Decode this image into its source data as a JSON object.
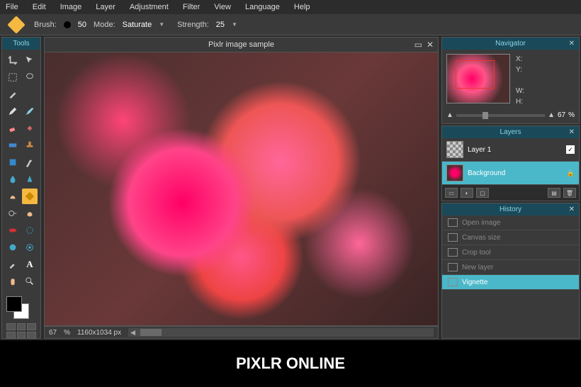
{
  "menu": {
    "file": "File",
    "edit": "Edit",
    "image": "Image",
    "layer": "Layer",
    "adjustment": "Adjustment",
    "filter": "Filter",
    "view": "View",
    "language": "Language",
    "help": "Help"
  },
  "options": {
    "brush_label": "Brush:",
    "brush_value": "50",
    "mode_label": "Mode:",
    "mode_value": "Saturate",
    "strength_label": "Strength:",
    "strength_value": "25"
  },
  "tools_header": "Tools",
  "canvas": {
    "title": "Pixlr image sample",
    "zoom": "67",
    "zoom_unit": "%",
    "dims": "1160x1034 px"
  },
  "navigator": {
    "title": "Navigator",
    "x": "X:",
    "y": "Y:",
    "w": "W:",
    "h": "H:",
    "zoom": "67",
    "unit": "%"
  },
  "layers": {
    "title": "Layers",
    "items": [
      {
        "name": "Layer 1",
        "selected": false,
        "checked": true
      },
      {
        "name": "Background",
        "selected": true,
        "locked": true
      }
    ]
  },
  "history": {
    "title": "History",
    "items": [
      {
        "label": "Open image",
        "selected": false
      },
      {
        "label": "Canvas size",
        "selected": false
      },
      {
        "label": "Crop tool",
        "selected": false
      },
      {
        "label": "New layer",
        "selected": false
      },
      {
        "label": "Vignette",
        "selected": true
      }
    ]
  },
  "caption": "PIXLR ONLINE"
}
